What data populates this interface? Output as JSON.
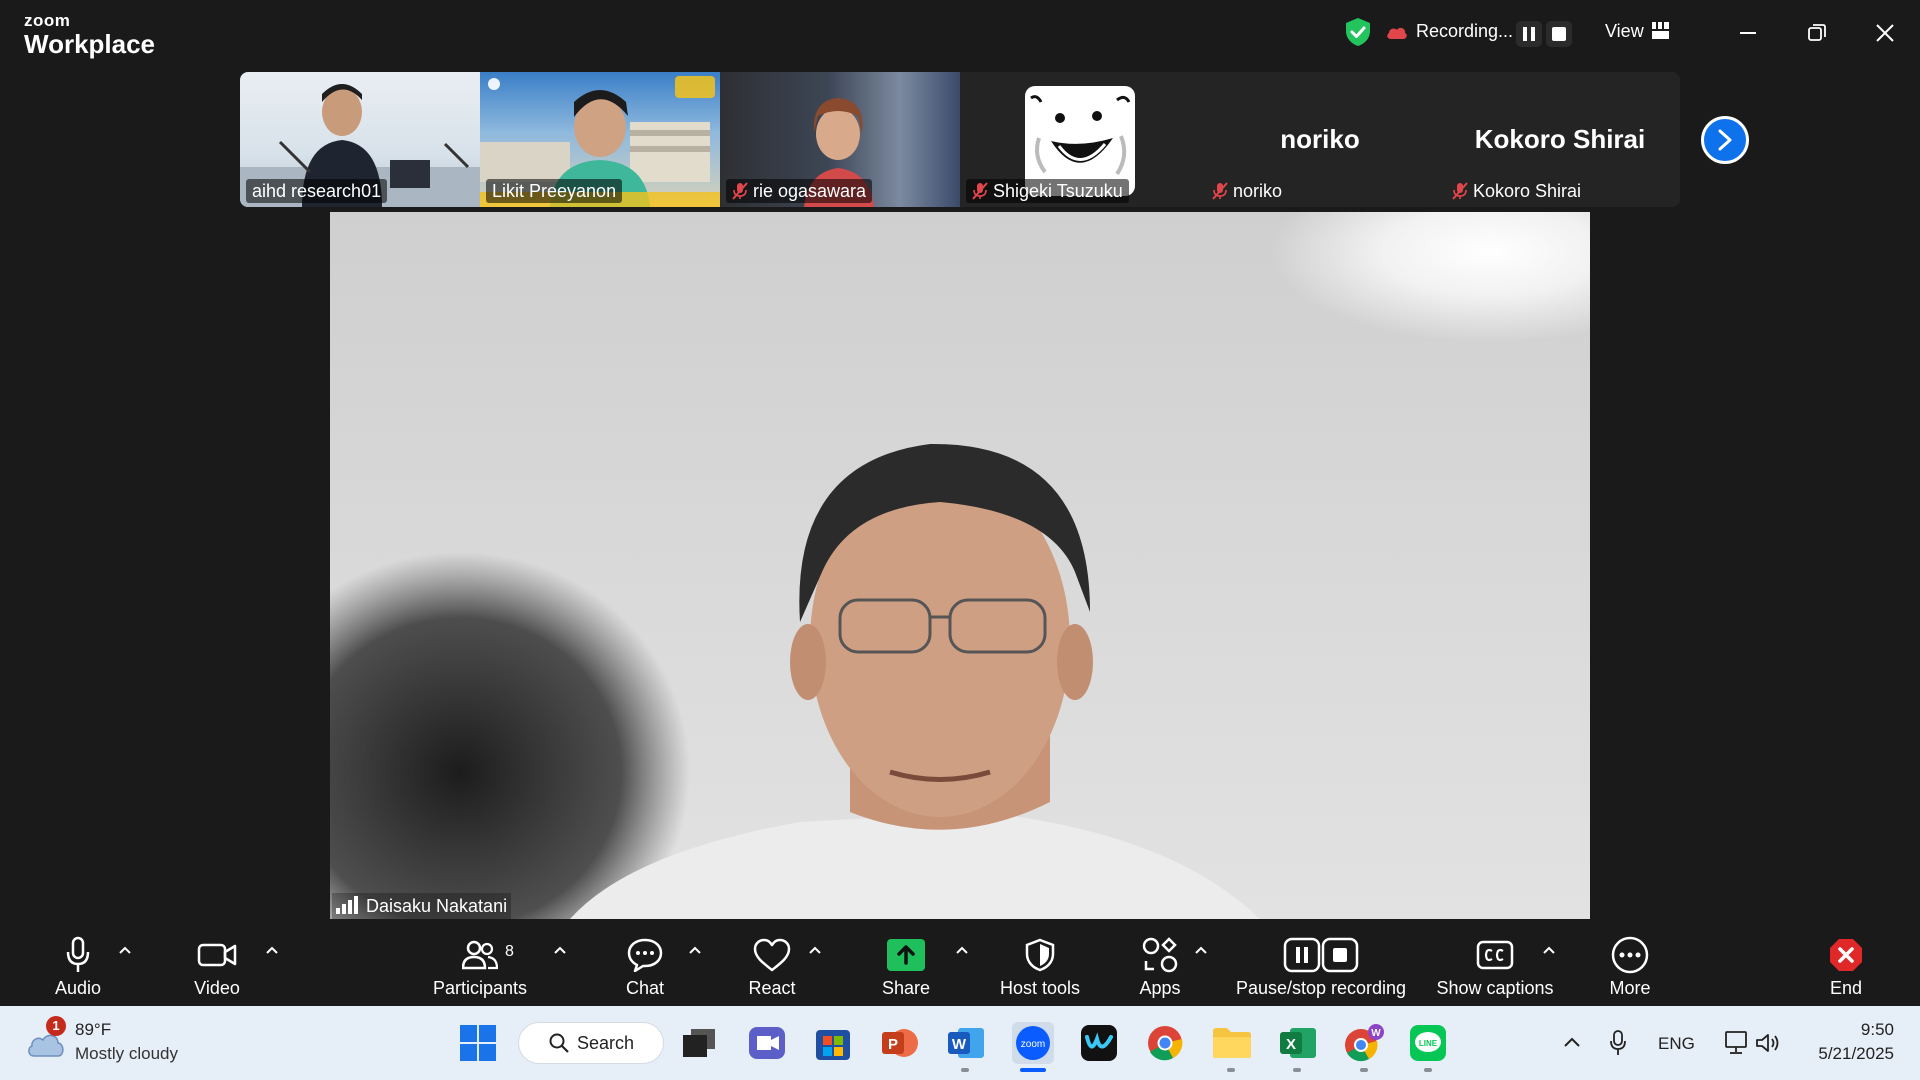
{
  "app": {
    "brand_small": "zoom",
    "brand_big": "Workplace"
  },
  "recording": {
    "status": "Recording..."
  },
  "view": {
    "label": "View"
  },
  "gallery": {
    "tiles": [
      {
        "name": "aihd research01",
        "muted": false,
        "type": "video"
      },
      {
        "name": "Likit Preeyanon",
        "muted": false,
        "type": "video"
      },
      {
        "name": "rie ogasawara",
        "muted": true,
        "type": "video"
      },
      {
        "name": "Shigeki Tsuzuku",
        "muted": true,
        "type": "avatar"
      },
      {
        "name": "noriko",
        "muted": true,
        "type": "name",
        "display": "noriko"
      },
      {
        "name": "Kokoro Shirai",
        "muted": true,
        "type": "name",
        "display": "Kokoro Shirai"
      }
    ]
  },
  "main_video": {
    "name": "Daisaku Nakatani"
  },
  "toolbar": {
    "audio": "Audio",
    "video": "Video",
    "participants": "Participants",
    "participants_count": "8",
    "chat": "Chat",
    "react": "React",
    "share": "Share",
    "host_tools": "Host tools",
    "apps": "Apps",
    "pause_stop": "Pause/stop recording",
    "captions": "Show captions",
    "more": "More",
    "end": "End"
  },
  "taskbar": {
    "weather_badge": "1",
    "weather_temp": "89°F",
    "weather_desc": "Mostly cloudy",
    "search_label": "Search",
    "language": "ENG",
    "time": "9:50",
    "date": "5/21/2025",
    "zoom_icon_text": "zoom",
    "line_icon_text": "LINE"
  },
  "colors": {
    "accent_blue": "#0e72ed",
    "share_green": "#1fbf5c",
    "end_red": "#e02828",
    "shield_green": "#23c45e",
    "mute_red": "#e0464a"
  }
}
